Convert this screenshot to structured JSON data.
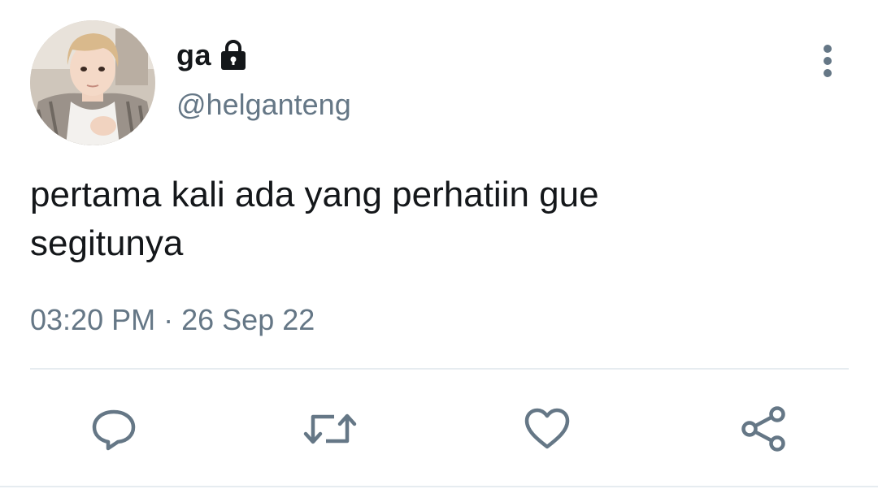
{
  "user": {
    "display_name": "ga",
    "handle": "@helganteng",
    "protected_icon": "lock-icon"
  },
  "tweet": {
    "text_lines": [
      "pertama kali ada yang perhatiin gue",
      "segitunya"
    ],
    "time": "03:20 PM",
    "separator": "·",
    "date": "26 Sep 22"
  },
  "actions": {
    "reply_icon": "speech-bubble-icon",
    "retweet_icon": "retweet-icon",
    "like_icon": "heart-icon",
    "share_icon": "share-icon"
  },
  "colors": {
    "text_primary": "#14171a",
    "text_secondary": "#657786",
    "icon": "#657786",
    "divider": "#e6ecf0"
  }
}
